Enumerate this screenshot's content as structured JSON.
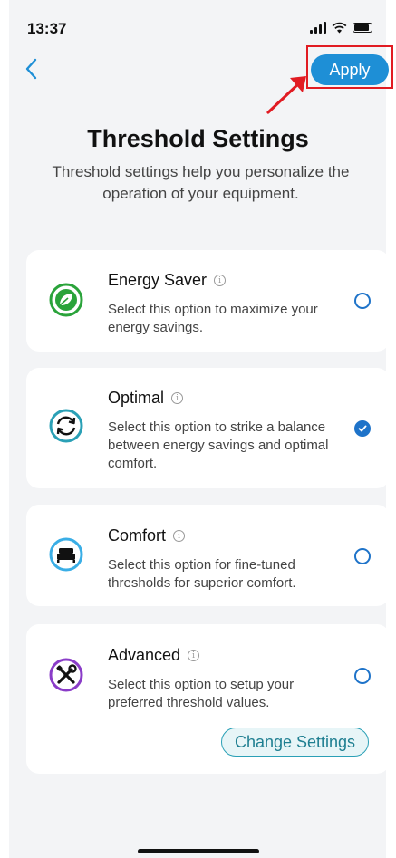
{
  "status_bar": {
    "time": "13:37"
  },
  "header": {
    "apply_label": "Apply"
  },
  "page": {
    "title": "Threshold Settings",
    "subtitle": "Threshold settings help you personalize the operation of your equipment."
  },
  "options": [
    {
      "title": "Energy Saver",
      "description": "Select this option to maximize your energy savings.",
      "selected": false,
      "icon": "leaf-icon",
      "color": "#2aa33a"
    },
    {
      "title": "Optimal",
      "description": "Select this option to strike a balance between energy savings and optimal comfort.",
      "selected": true,
      "icon": "cycle-arrows-icon",
      "color": "#2aa0b6"
    },
    {
      "title": "Comfort",
      "description": "Select this option for fine-tuned thresholds for superior comfort.",
      "selected": false,
      "icon": "bed-icon",
      "color": "#3aaee6"
    },
    {
      "title": "Advanced",
      "description": "Select this option to setup your preferred threshold values.",
      "selected": false,
      "icon": "tools-icon",
      "color": "#8a3cc8"
    }
  ],
  "advanced": {
    "change_settings_label": "Change Settings"
  },
  "colors": {
    "accent": "#1e8fd6",
    "radio": "#1e73c9",
    "annotation": "#e11b22"
  }
}
